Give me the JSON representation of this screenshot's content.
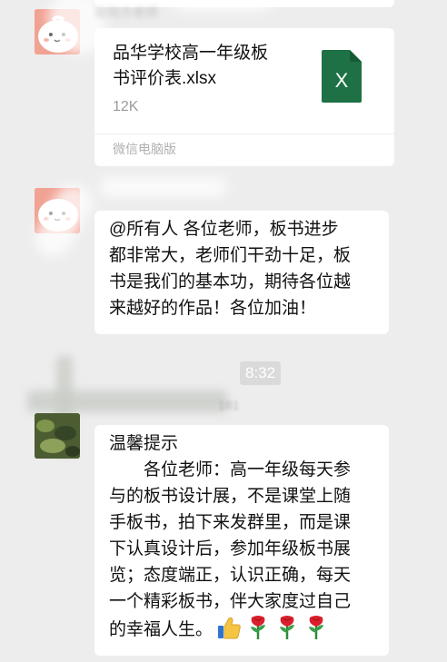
{
  "messages": [
    {
      "type": "file",
      "sender": "往何方老师",
      "file": {
        "name": "品华学校高一年级板书评价表.xlsx",
        "name_lines": [
          "品华学校高一年级板",
          "书评价表.xlsx"
        ],
        "size": "12K",
        "source": "微信电脑版",
        "icon": "excel-file-icon",
        "icon_letter": "X",
        "icon_color": "#1e7145"
      }
    },
    {
      "type": "text",
      "sender": "",
      "lines": [
        "@所有人 各位老师，板书进步",
        "都非常大，老师们干劲十足，板",
        "书是我们的基本功，期待各位越",
        "来越好的作品！各位加油！"
      ]
    },
    {
      "type": "text",
      "sender": "181",
      "lines": [
        "温馨提示",
        "　　各位老师：高一年级每天参",
        "与的板书设计展，不是课堂上随",
        "手板书，拍下来发群里，而是课",
        "下认真设计后，参加年级板书展",
        "览；态度端正，认识正确，每天",
        "一个精彩板书，伴大家度过自己",
        "的幸福人生。"
      ],
      "emojis": [
        "thumbs-up-icon",
        "rose-icon",
        "rose-icon",
        "rose-icon"
      ]
    }
  ],
  "timestamp": "8:32",
  "colors": {
    "background": "#ededed",
    "bubble": "#ffffff",
    "excel_green": "#1e7145",
    "avatar_pink": "#f0a293"
  }
}
